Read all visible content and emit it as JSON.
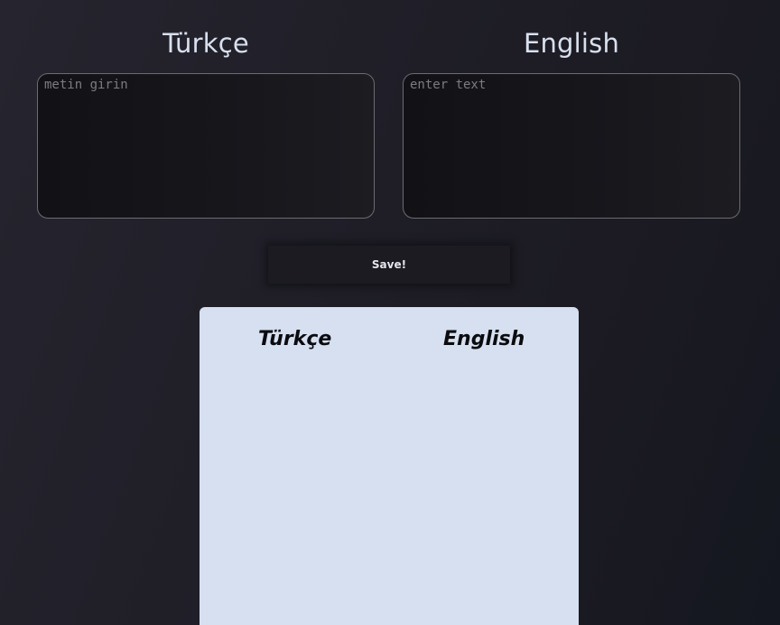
{
  "turkish": {
    "heading": "Türkçe",
    "input_placeholder": "metin girin",
    "input_value": ""
  },
  "english": {
    "heading": "English",
    "input_placeholder": "enter text",
    "input_value": ""
  },
  "save_button": {
    "label": "Save!"
  },
  "saved_list": {
    "columns": [
      "Türkçe",
      "English"
    ],
    "rows": []
  },
  "colors": {
    "background": "#1f1e27",
    "heading_text": "#d8e0ee",
    "panel_background": "#d6e0f0",
    "panel_heading_text": "#0b0b10",
    "input_border": "#6c6b73"
  }
}
